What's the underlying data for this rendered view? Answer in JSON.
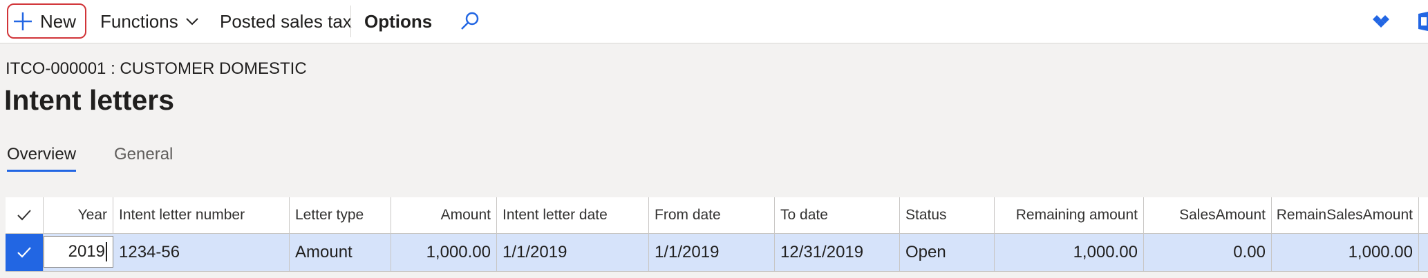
{
  "toolbar": {
    "new_label": "New",
    "functions_label": "Functions",
    "posted_sales_tax_label": "Posted sales tax",
    "options_label": "Options"
  },
  "header": {
    "breadcrumb": "ITCO-000001 : CUSTOMER DOMESTIC",
    "title": "Intent letters"
  },
  "tabs": [
    {
      "label": "Overview",
      "active": true
    },
    {
      "label": "General",
      "active": false
    }
  ],
  "grid": {
    "columns": [
      "Year",
      "Intent letter number",
      "Letter type",
      "Amount",
      "Intent letter date",
      "From date",
      "To date",
      "Status",
      "Remaining amount",
      "SalesAmount",
      "RemainSalesAmount"
    ],
    "rows": [
      [
        "2019",
        "1234-56",
        "Amount",
        "1,000.00",
        "1/1/2019",
        "1/1/2019",
        "12/31/2019",
        "Open",
        "1,000.00",
        "0.00",
        "1,000.00"
      ]
    ]
  },
  "colors": {
    "accent": "#2266e3",
    "selected_row": "#d6e3fa",
    "highlight_outline": "#d13438"
  },
  "icons": [
    "plus-icon",
    "chevron-down-icon",
    "search-icon",
    "diamond-icon",
    "office-icon",
    "checkmark-icon"
  ]
}
